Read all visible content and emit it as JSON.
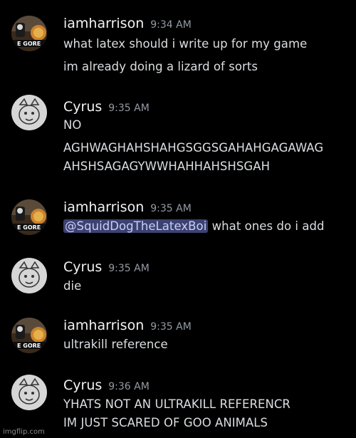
{
  "messages": [
    {
      "author": "iamharrison",
      "avatar": "harrison-avatar",
      "time": "9:34 AM",
      "lines": [
        "what latex should i write up for my game",
        "im already doing a lizard of sorts"
      ]
    },
    {
      "author": "Cyrus",
      "avatar": "cyrus-avatar",
      "time": "9:35 AM",
      "lines": [
        "NO",
        "AGHWAGHAHSHAHGSGGSGAHAHGAGAWAG",
        "AHSHSAGAGYWWHAHHAHSHSGAH"
      ]
    },
    {
      "author": "iamharrison",
      "avatar": "harrison-avatar",
      "time": "9:35 AM",
      "mention": "@SquidDogTheLatexBoi",
      "lines": [
        " what ones do i add"
      ]
    },
    {
      "author": "Cyrus",
      "avatar": "cyrus-avatar",
      "time": "9:35 AM",
      "lines": [
        "die"
      ]
    },
    {
      "author": "iamharrison",
      "avatar": "harrison-avatar",
      "time": "9:35 AM",
      "lines": [
        "ultrakill reference"
      ]
    },
    {
      "author": "Cyrus",
      "avatar": "cyrus-avatar",
      "time": "9:36 AM",
      "lines": [
        "YHATS NOT AN ULTRAKILL REFERENCR",
        "IM JUST SCARED OF GOO ANIMALS"
      ]
    }
  ],
  "avatar_caption": "E GORE",
  "watermark": "imgflip.com",
  "colors": {
    "background": "#000000",
    "mention_bg": "#3c4270",
    "mention_text": "#c9cdfb"
  }
}
